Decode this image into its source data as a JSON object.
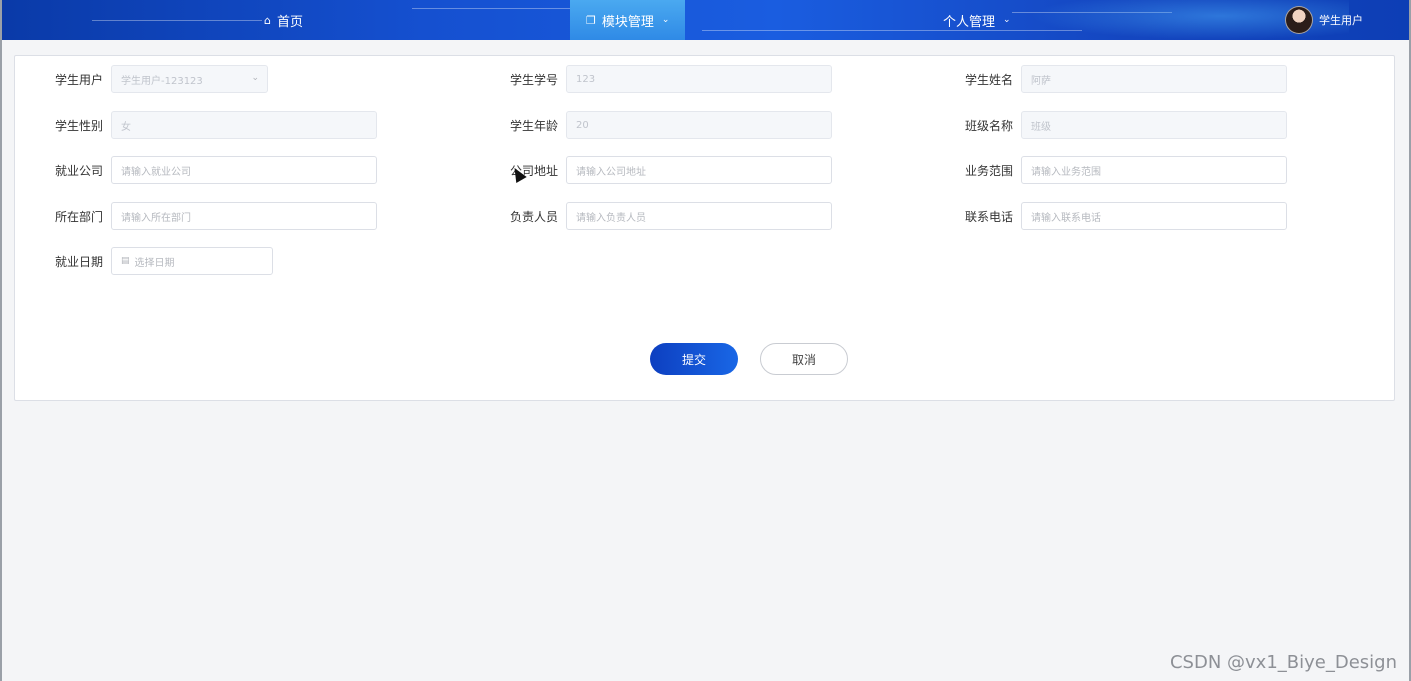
{
  "nav": {
    "home": {
      "label": "首页",
      "icon": "home-icon"
    },
    "modules": {
      "label": "模块管理",
      "icon": "copy-icon",
      "active": true
    },
    "personal": {
      "label": "个人管理"
    },
    "user": {
      "name": "学生用户",
      "avatar": "avatar-image"
    }
  },
  "form": {
    "rows": [
      [
        {
          "label": "学生用户",
          "value": "学生用户-123123",
          "type": "select",
          "disabled": true
        },
        {
          "label": "学生学号",
          "value": "123",
          "disabled": true
        },
        {
          "label": "学生姓名",
          "value": "阿萨",
          "disabled": true
        }
      ],
      [
        {
          "label": "学生性别",
          "value": "女",
          "disabled": true
        },
        {
          "label": "学生年龄",
          "value": "20",
          "disabled": true
        },
        {
          "label": "班级名称",
          "value": "班级",
          "disabled": true
        }
      ],
      [
        {
          "label": "就业公司",
          "placeholder": "请输入就业公司"
        },
        {
          "label": "公司地址",
          "placeholder": "请输入公司地址"
        },
        {
          "label": "业务范围",
          "placeholder": "请输入业务范围"
        }
      ],
      [
        {
          "label": "所在部门",
          "placeholder": "请输入所在部门"
        },
        {
          "label": "负责人员",
          "placeholder": "请输入负责人员"
        },
        {
          "label": "联系电话",
          "placeholder": "请输入联系电话"
        }
      ],
      [
        {
          "label": "就业日期",
          "placeholder": "选择日期",
          "type": "date"
        }
      ]
    ],
    "submit_label": "提交",
    "cancel_label": "取消"
  },
  "watermark": "CSDN @vx1_Biye_Design",
  "colors": {
    "nav_bg": "#1550d0",
    "primary": "#1967e6",
    "active_tab": "#3a98ea"
  }
}
